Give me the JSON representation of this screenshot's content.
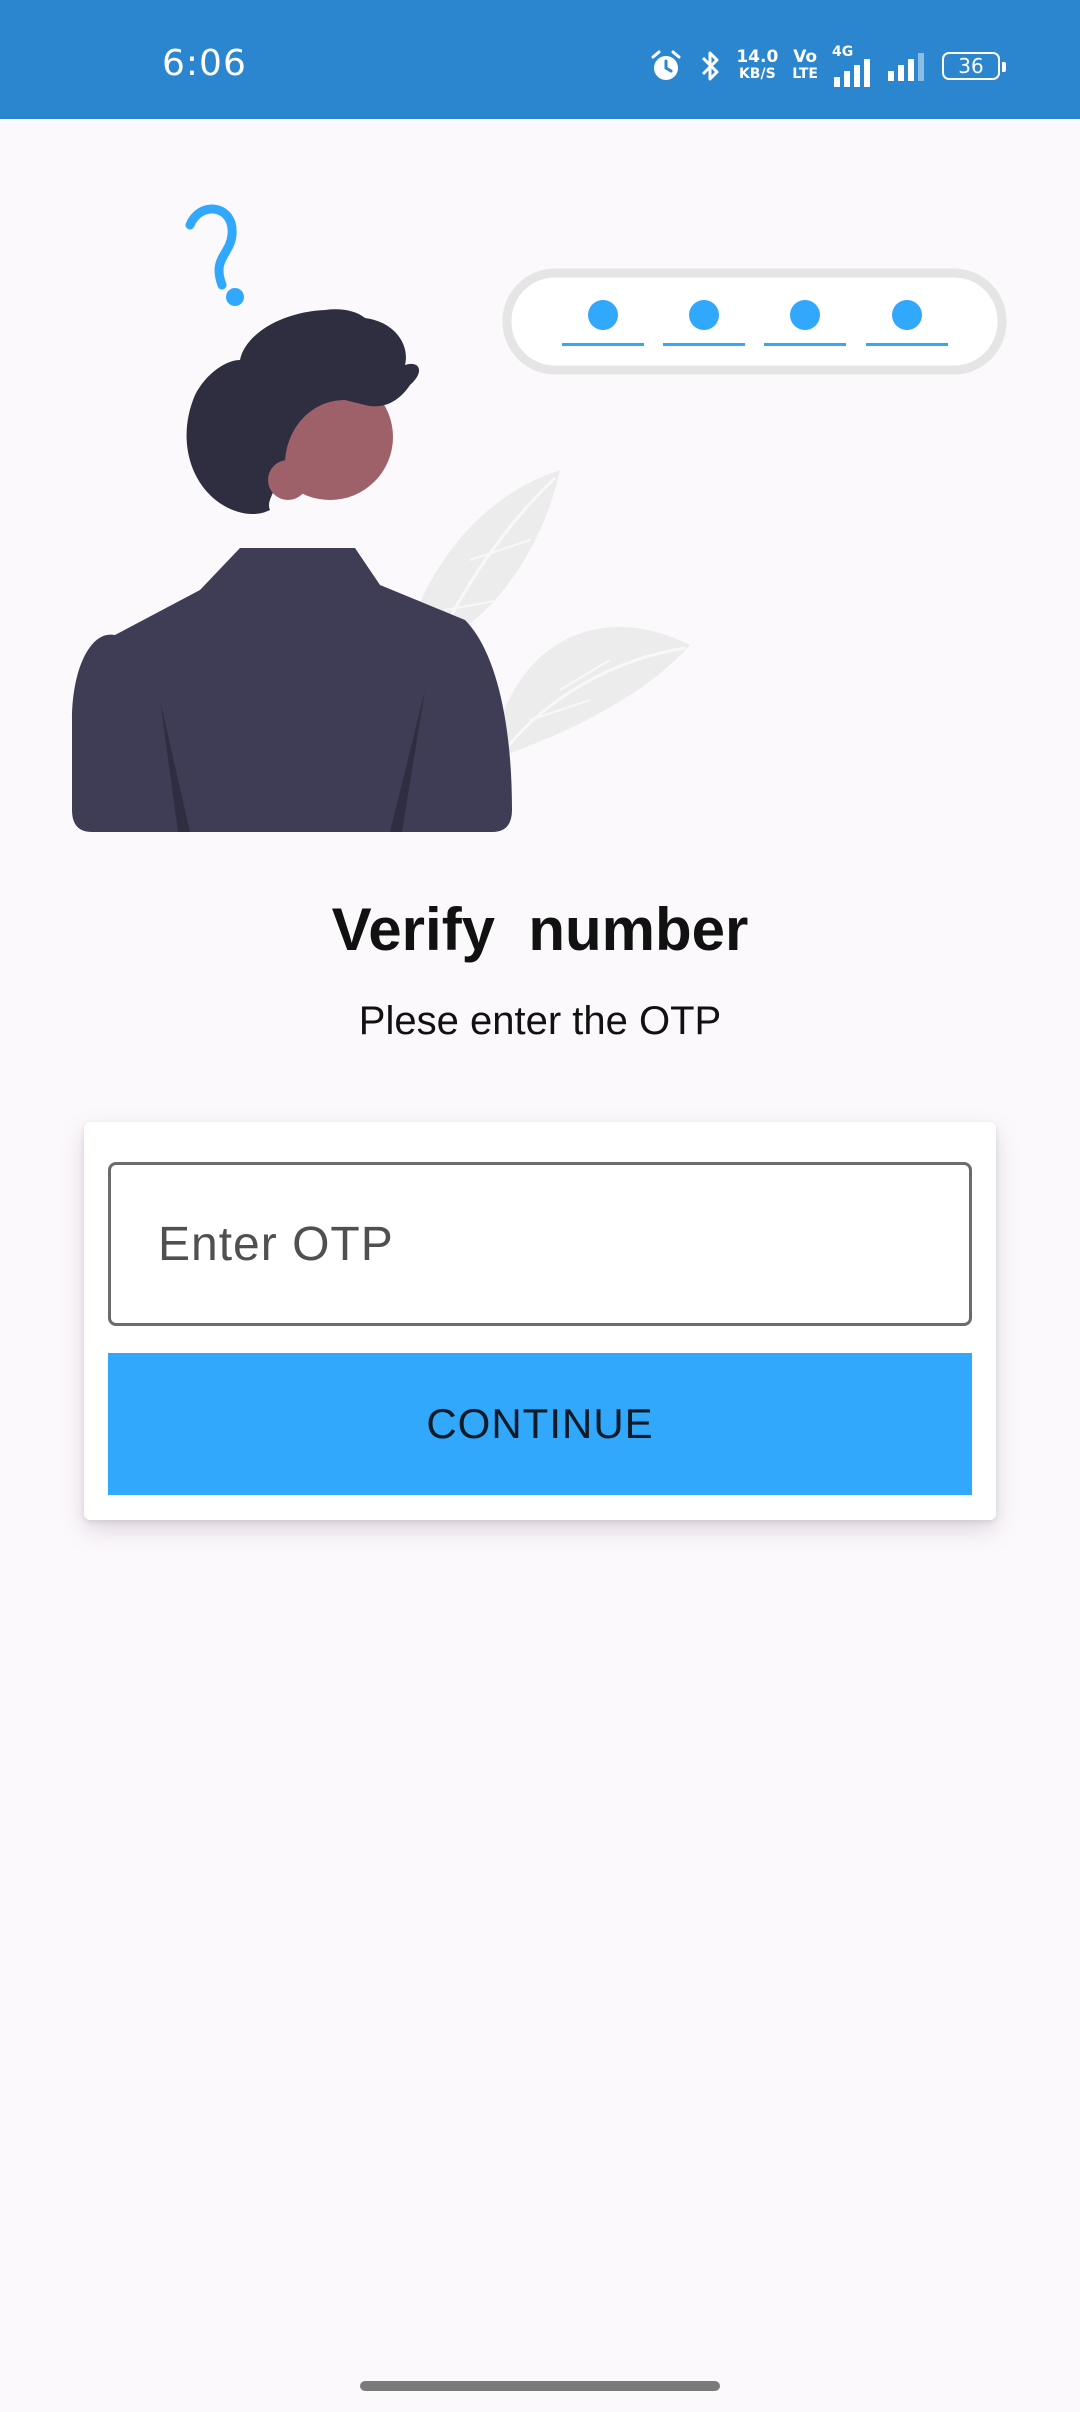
{
  "status_bar": {
    "time": "6:06",
    "net_speed_value": "14.0",
    "net_speed_unit": "KB/S",
    "volte_top": "Vo",
    "volte_bottom": "LTE",
    "network_type": "4G",
    "battery": "36"
  },
  "verify": {
    "title": "Verify  number",
    "subtitle": "Plese enter the OTP",
    "otp_placeholder": "Enter OTP",
    "continue_label": "CONTINUE"
  },
  "colors": {
    "status_bar": "#2b86cf",
    "accent": "#32a8fd",
    "background": "#fcf9fc"
  },
  "icons": [
    "alarm-icon",
    "bluetooth-icon",
    "signal-icon",
    "battery-icon"
  ]
}
